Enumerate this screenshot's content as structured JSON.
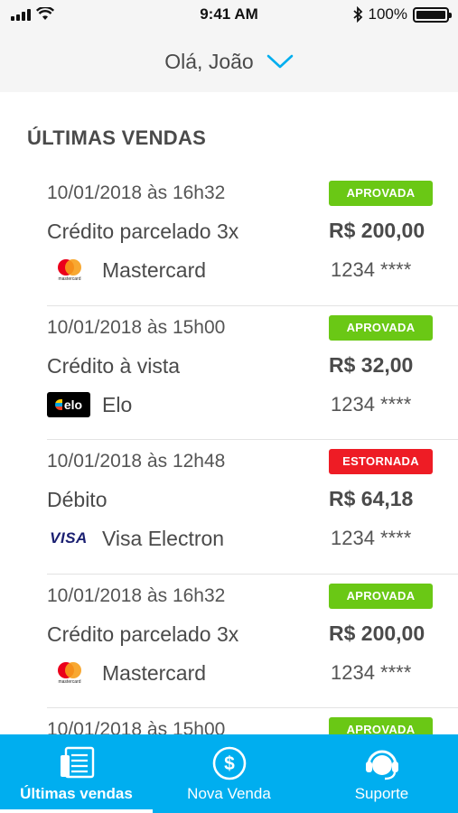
{
  "status_bar": {
    "time": "9:41 AM",
    "battery": "100%"
  },
  "header": {
    "greeting": "Olá, João"
  },
  "section_title": "ÚLTIMAS VENDAS",
  "sales": [
    {
      "datetime": "10/01/2018 às 16h32",
      "status": "APROVADA",
      "type": "Crédito parcelado 3x",
      "amount": "R$ 200,00",
      "brand": "Mastercard",
      "card": "1234 ****"
    },
    {
      "datetime": "10/01/2018 às 15h00",
      "status": "APROVADA",
      "type": "Crédito à vista",
      "amount": "R$ 32,00",
      "brand": "Elo",
      "card": "1234 ****"
    },
    {
      "datetime": "10/01/2018 às 12h48",
      "status": "ESTORNADA",
      "type": "Débito",
      "amount": "R$ 64,18",
      "brand": "Visa Electron",
      "card": "1234 ****"
    },
    {
      "datetime": "10/01/2018 às 16h32",
      "status": "APROVADA",
      "type": "Crédito parcelado 3x",
      "amount": "R$ 200,00",
      "brand": "Mastercard",
      "card": "1234 ****"
    },
    {
      "datetime": "10/01/2018 às 15h00",
      "status": "APROVADA",
      "type": "",
      "amount": "",
      "brand": "",
      "card": ""
    }
  ],
  "logos": {
    "mastercard_text": "mastercard",
    "elo_text": "elo",
    "visa_text": "VISA"
  },
  "bottom_nav": [
    {
      "label": "Últimas vendas",
      "icon": "receipt-list-icon",
      "active": true
    },
    {
      "label": "Nova Venda",
      "icon": "dollar-circle-icon",
      "active": false
    },
    {
      "label": "Suporte",
      "icon": "headset-support-icon",
      "active": false
    }
  ],
  "colors": {
    "primary": "#00aeef",
    "approved": "#6ac815",
    "reversed": "#ee1c25",
    "text": "#4a4a4a"
  }
}
